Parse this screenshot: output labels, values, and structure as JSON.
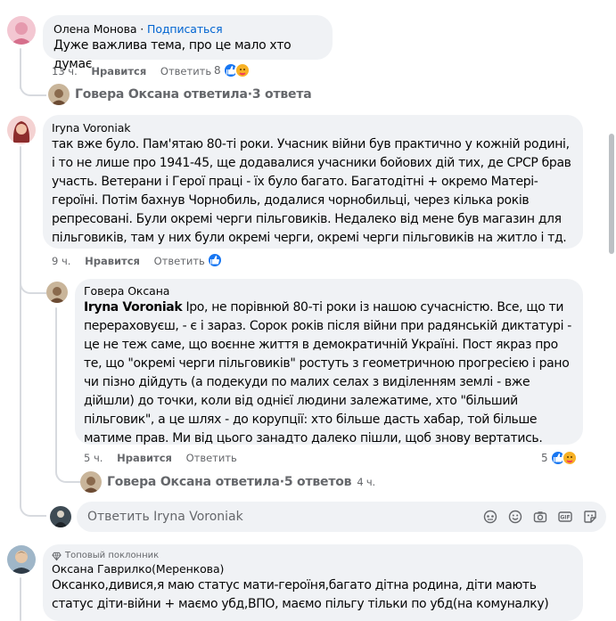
{
  "comments": [
    {
      "author": "Олена Монова",
      "separator": " · ",
      "follow_label": "Подписаться",
      "text": "Дуже важлива тема, про це мало хто думає",
      "time": "13 ч.",
      "like_label": "Нравится",
      "reply_label": "Ответить",
      "reaction_count": "8",
      "reply_summary": {
        "name": "Говера Оксана",
        "action": "ответила",
        "dot": " · ",
        "count": "3 ответа"
      }
    },
    {
      "author": "Iryna Voroniak",
      "text": "так вже було. Пам'ятаю 80-ті роки. Учасник війни був практично у кожній родині, і то не лише про 1941-45, ще додавалися учасники бойових дій тих, де СРСР брав участь. Ветерани і Герої праці - їх було багато. Багатодітні + окремо Матері-героїні. Потім бахнув Чорнобиль, додалися чорнобильці, через кілька років репресовані. Були окремі черги пільговиків. Недалеко від мене був магазин для пільговиків, там у них були окремі черги, окремі черги пільговиків на житло і тд.",
      "time": "9 ч.",
      "like_label": "Нравится",
      "reply_label": "Ответить",
      "reply": {
        "author": "Говера Оксана",
        "mention": "Iryna Voroniak",
        "text": " Іро, не порівнюй 80-ті роки із нашою сучасністю. Все, що ти перераховуєш, - є і зараз. Сорок років після війни при радянській диктатурі - це не теж саме, що воєнне життя в демократичній Україні. Пост якраз про те, що \"окремі черги пільговиків\" ростуть з геометричною прогресією і рано чи пізно дійдуть (а подекуди по малих селах з виділенням землі - вже дійшли) до точки, коли від однієї людини залежатиме, хто \"більший пільговик\", а це шлях - до корупції: хто більше дасть хабар, той більше матиме прав. Ми від цього занадто далеко пішли, щоб знову вертатись.",
        "time": "5 ч.",
        "like_label": "Нравится",
        "reply_label": "Ответить",
        "reaction_count": "5"
      },
      "reply_summary": {
        "name": "Говера Оксана",
        "action": "ответила",
        "dot": " · ",
        "count": "5 ответов",
        "time": "4 ч."
      },
      "input_placeholder": "Ответить Iryna Voroniak"
    },
    {
      "badge": "Топовый поклонник",
      "author": "Оксана Гаврилко(Меренкова)",
      "text": "Оксанко,дивися,я маю статус мати-героїня,багато дітна родина, діти мають статус діти-війни + маємо убд,ВПО, маємо пільгу тільки по убд(на комуналку)"
    }
  ],
  "colors": {
    "like_blue": "#1877f2",
    "link_blue": "#0064d1",
    "bubble_bg": "#f0f2f5",
    "meta_gray": "#65676b"
  },
  "icons": [
    "like-reaction-icon",
    "care-reaction-icon",
    "sticker-icon",
    "emoji-icon",
    "camera-icon",
    "gif-icon",
    "avatar-sticker-icon",
    "diamond-badge-icon"
  ]
}
